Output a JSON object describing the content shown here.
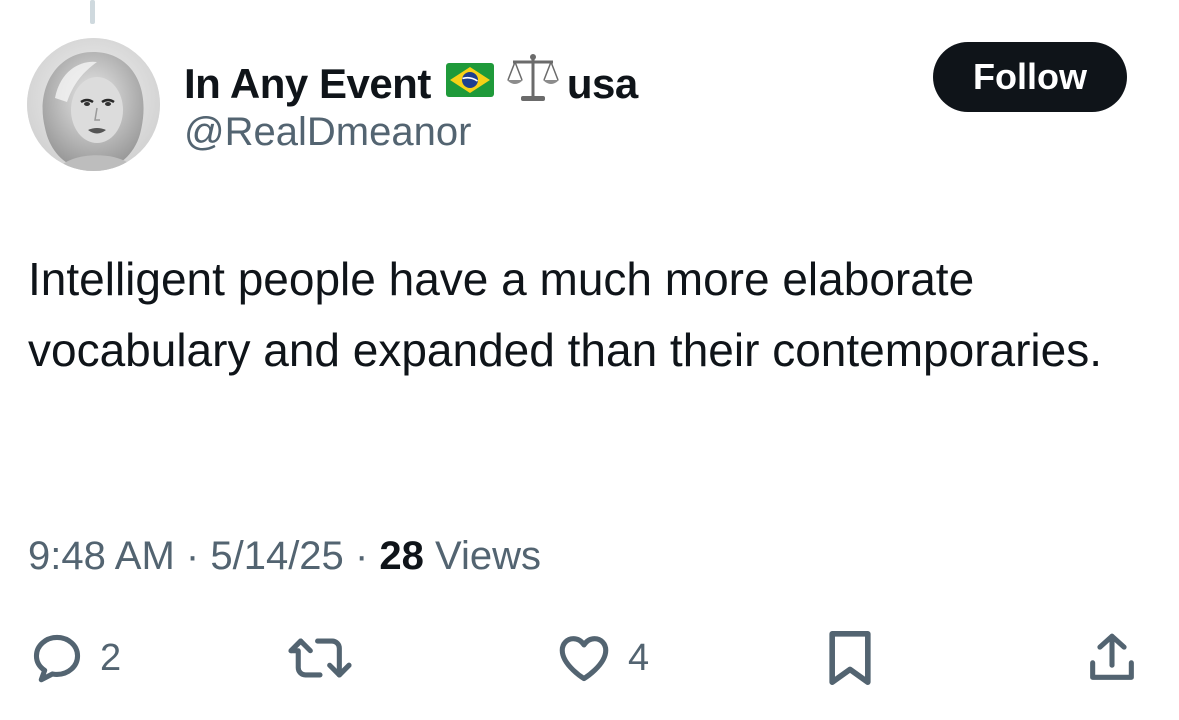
{
  "author": {
    "display_name": "In Any Event",
    "display_name_suffix": "usa",
    "name_emojis": [
      "brazil-flag-icon",
      "balance-scale-icon"
    ],
    "handle": "@RealDmeanor",
    "avatar": "avatar-photo"
  },
  "follow_button": {
    "label": "Follow"
  },
  "tweet": {
    "text": "Intelligent people have a much more elaborate vocabulary and expanded than their contemporaries."
  },
  "meta": {
    "time": "9:48 AM",
    "separator": "·",
    "date": "5/14/25",
    "views_count": "28",
    "views_label": "Views"
  },
  "actions": {
    "reply": {
      "icon": "reply-icon",
      "count": "2"
    },
    "retweet": {
      "icon": "retweet-icon",
      "count": ""
    },
    "like": {
      "icon": "heart-icon",
      "count": "4"
    },
    "bookmark": {
      "icon": "bookmark-icon"
    },
    "share": {
      "icon": "share-icon"
    }
  },
  "colors": {
    "text_primary": "#0f1419",
    "text_secondary": "#536471",
    "follow_bg": "#0f1419",
    "follow_text": "#ffffff",
    "thread_line": "#cfd9de"
  }
}
